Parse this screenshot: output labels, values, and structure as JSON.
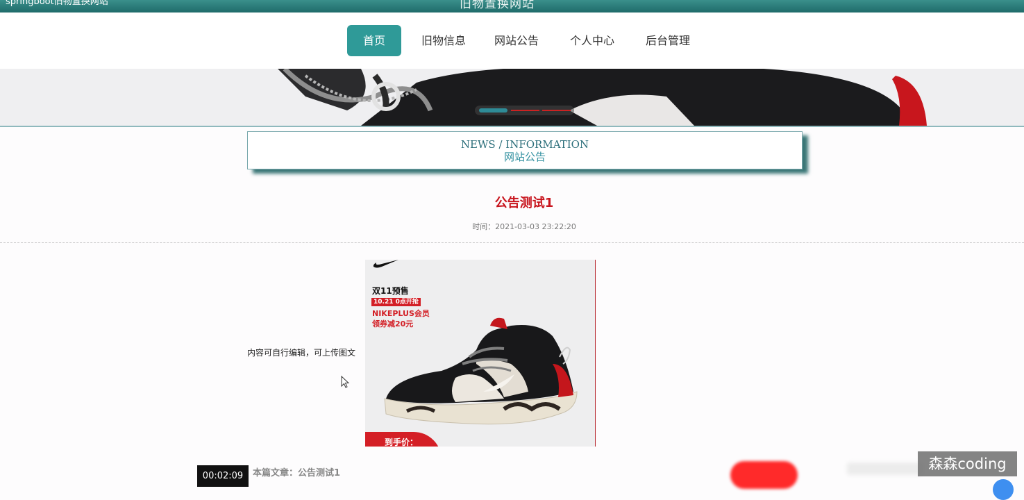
{
  "topbar": {
    "left_text": "springboot旧物置换网站",
    "site_title": "旧物置换网站"
  },
  "nav": {
    "items": [
      {
        "label": "首页"
      },
      {
        "label": "旧物信息"
      },
      {
        "label": "网站公告"
      },
      {
        "label": "个人中心"
      },
      {
        "label": "后台管理"
      }
    ]
  },
  "section": {
    "en_title": "NEWS / INFORMATION",
    "cn_title": "网站公告"
  },
  "article": {
    "title": "公告测试1",
    "time": "时间：2021-03-03 23:22:20",
    "body_text": "内容可自行编辑，可上传图文",
    "image": {
      "line1": "双11预售",
      "line2": "10.21  0点开抢",
      "line3": "NIKEPLUS会员",
      "line4": "领券减20元",
      "line5": "到手价："
    },
    "footer_label": "本篇文章：公告测试1"
  },
  "overlay": {
    "timer": "00:02:09",
    "watermark": "森森coding"
  },
  "colors": {
    "accent": "#2f9a98",
    "title_red": "#c8141d"
  }
}
